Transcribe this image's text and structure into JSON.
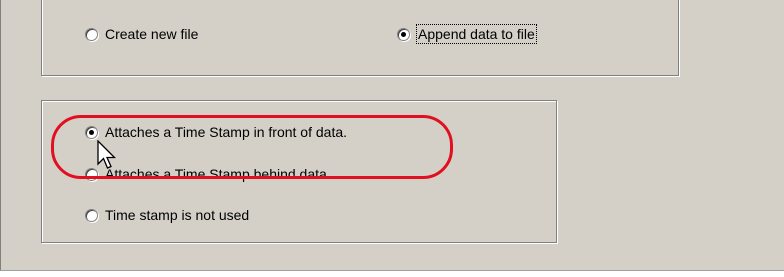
{
  "file_mode": {
    "options": [
      {
        "label": "Create new file",
        "checked": false
      },
      {
        "label": "Append data to file",
        "checked": true
      }
    ]
  },
  "time_stamp": {
    "options": [
      {
        "label": "Attaches a Time Stamp in front of data.",
        "checked": true
      },
      {
        "label": "Attaches a Time Stamp behind data.",
        "checked": false
      },
      {
        "label": "Time stamp is not used",
        "checked": false
      }
    ]
  },
  "annotation": {
    "highlight_color": "#e01020",
    "cursor_icon": "arrow-cursor-icon"
  },
  "colors": {
    "panel": "#d4d0c8",
    "border": "#808080"
  }
}
